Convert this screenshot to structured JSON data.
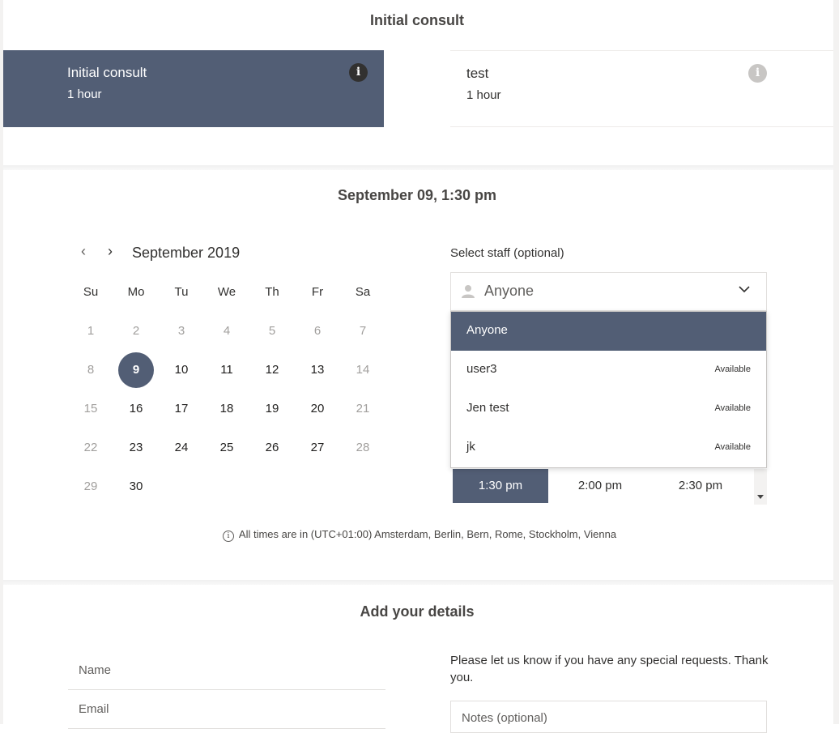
{
  "services": {
    "heading": "Initial consult",
    "items": [
      {
        "name": "Initial consult",
        "duration": "1 hour",
        "info_icon": "i"
      },
      {
        "name": "test",
        "duration": "1 hour",
        "info_icon": "i"
      }
    ]
  },
  "datetime": {
    "heading": "September 09, 1:30 pm"
  },
  "calendar": {
    "month_label": "September 2019",
    "prev_icon": "‹",
    "next_icon": "›",
    "weekdays": [
      "Su",
      "Mo",
      "Tu",
      "We",
      "Th",
      "Fr",
      "Sa"
    ],
    "weeks": [
      [
        "1",
        "2",
        "3",
        "4",
        "5",
        "6",
        "7"
      ],
      [
        "8",
        "9",
        "10",
        "11",
        "12",
        "13",
        "14"
      ],
      [
        "15",
        "16",
        "17",
        "18",
        "19",
        "20",
        "21"
      ],
      [
        "22",
        "23",
        "24",
        "25",
        "26",
        "27",
        "28"
      ],
      [
        "29",
        "30"
      ]
    ],
    "selected_day": "9"
  },
  "staff": {
    "label": "Select staff (optional)",
    "selected": "Anyone",
    "options": [
      {
        "name": "Anyone",
        "status": ""
      },
      {
        "name": "user3",
        "status": "Available"
      },
      {
        "name": "Jen test",
        "status": "Available"
      },
      {
        "name": "jk",
        "status": "Available"
      }
    ]
  },
  "times": {
    "slots": [
      "1:30 pm",
      "2:00 pm",
      "2:30 pm"
    ],
    "selected": "1:30 pm"
  },
  "timezone": {
    "icon": "i",
    "text": "All times are in (UTC+01:00) Amsterdam, Berlin, Bern, Rome, Stockholm, Vienna"
  },
  "details": {
    "heading": "Add your details",
    "name_placeholder": "Name",
    "email_placeholder": "Email",
    "requests_text": "Please let us know if you have any special requests. Thank you.",
    "notes_placeholder": "Notes (optional)"
  },
  "colors": {
    "accent": "#525e75",
    "disabled_text": "#a19f9d"
  }
}
